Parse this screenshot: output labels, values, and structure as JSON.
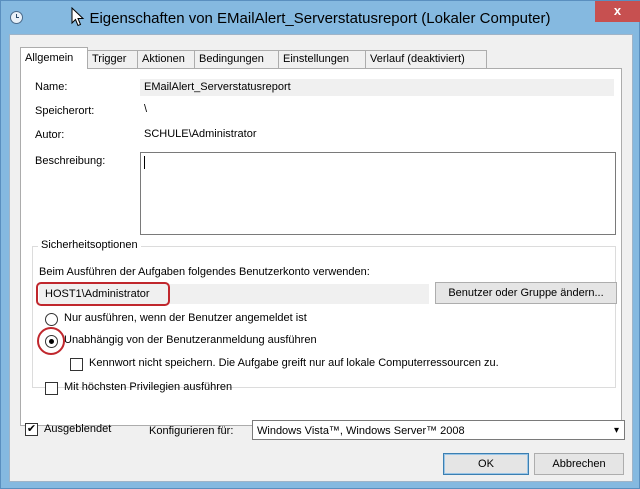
{
  "window": {
    "title": "Eigenschaften von EMailAlert_Serverstatusreport (Lokaler Computer)",
    "close_glyph": "x"
  },
  "tabs": [
    {
      "label": "Allgemein",
      "active": true
    },
    {
      "label": "Trigger"
    },
    {
      "label": "Aktionen"
    },
    {
      "label": "Bedingungen"
    },
    {
      "label": "Einstellungen"
    },
    {
      "label": "Verlauf (deaktiviert)"
    }
  ],
  "general": {
    "name_label": "Name:",
    "name_value": "EMailAlert_Serverstatusreport",
    "location_label": "Speicherort:",
    "location_value": "\\",
    "author_label": "Autor:",
    "author_value": "SCHULE\\Administrator",
    "description_label": "Beschreibung:",
    "description_value": ""
  },
  "security": {
    "group_title": "Sicherheitsoptionen",
    "account_prompt": "Beim Ausführen der Aufgaben folgendes Benutzerkonto verwenden:",
    "account_value": "HOST1\\Administrator",
    "change_user_button": "Benutzer oder Gruppe ändern...",
    "radio_logged_on": "Nur ausführen, wenn der Benutzer angemeldet ist",
    "radio_independent": "Unabhängig von der Benutzeranmeldung ausführen",
    "radio_selected": "independent",
    "no_password_label": "Kennwort nicht speichern. Die Aufgabe greift nur auf lokale Computerressourcen zu.",
    "no_password_checked": false,
    "highest_priv_label": "Mit höchsten Privilegien ausführen",
    "highest_priv_checked": false
  },
  "bottom": {
    "hidden_label": "Ausgeblendet",
    "hidden_checked": true,
    "hidden_check_glyph": "✔",
    "configure_label": "Konfigurieren für:",
    "configure_value": "Windows Vista™, Windows Server™ 2008",
    "ok_button": "OK",
    "cancel_button": "Abbrechen"
  },
  "colors": {
    "title_bar": "#85b9e0",
    "close_button": "#c75050",
    "highlight_annotation": "#c0272d"
  }
}
